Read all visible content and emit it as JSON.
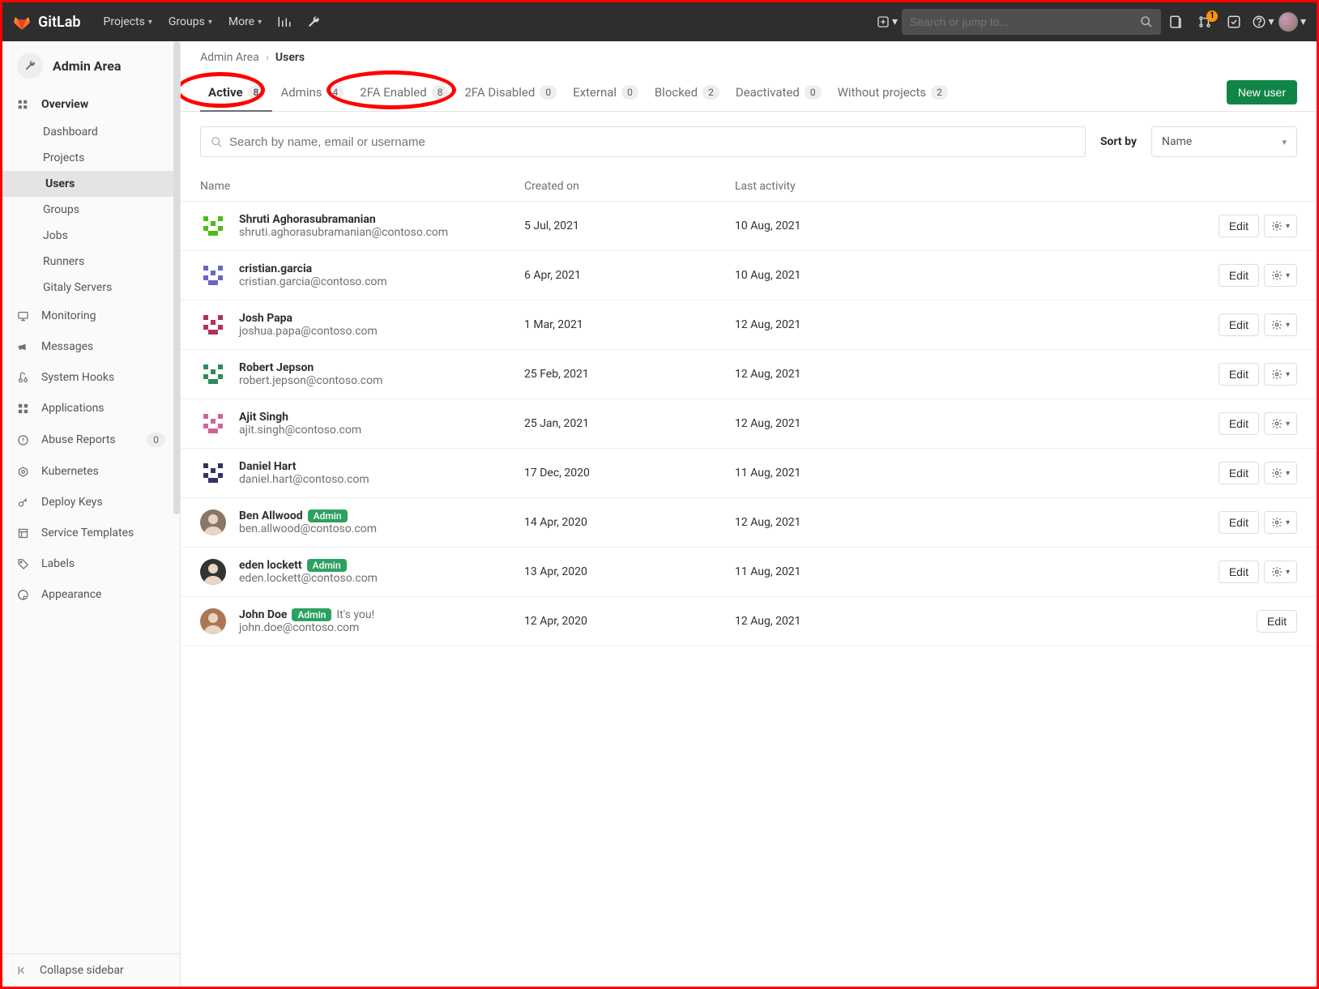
{
  "navbar": {
    "brand": "GitLab",
    "items": [
      "Projects",
      "Groups",
      "More"
    ],
    "search_placeholder": "Search or jump to...",
    "mr_badge": "1"
  },
  "sidebar": {
    "title": "Admin Area",
    "overview": {
      "label": "Overview",
      "items": [
        {
          "label": "Dashboard",
          "active": false
        },
        {
          "label": "Projects",
          "active": false
        },
        {
          "label": "Users",
          "active": true
        },
        {
          "label": "Groups",
          "active": false
        },
        {
          "label": "Jobs",
          "active": false
        },
        {
          "label": "Runners",
          "active": false
        },
        {
          "label": "Gitaly Servers",
          "active": false
        }
      ]
    },
    "links": [
      {
        "label": "Monitoring",
        "icon": "monitor"
      },
      {
        "label": "Messages",
        "icon": "bullhorn"
      },
      {
        "label": "System Hooks",
        "icon": "hook"
      },
      {
        "label": "Applications",
        "icon": "apps"
      },
      {
        "label": "Abuse Reports",
        "icon": "abuse",
        "count": "0"
      },
      {
        "label": "Kubernetes",
        "icon": "k8s"
      },
      {
        "label": "Deploy Keys",
        "icon": "key"
      },
      {
        "label": "Service Templates",
        "icon": "template"
      },
      {
        "label": "Labels",
        "icon": "label"
      },
      {
        "label": "Appearance",
        "icon": "appearance"
      }
    ],
    "collapse": "Collapse sidebar"
  },
  "breadcrumb": {
    "root": "Admin Area",
    "current": "Users"
  },
  "tabs": [
    {
      "label": "Active",
      "count": "8",
      "active": true
    },
    {
      "label": "Admins",
      "count": "4"
    },
    {
      "label": "2FA Enabled",
      "count": "8"
    },
    {
      "label": "2FA Disabled",
      "count": "0"
    },
    {
      "label": "External",
      "count": "0"
    },
    {
      "label": "Blocked",
      "count": "2"
    },
    {
      "label": "Deactivated",
      "count": "0"
    },
    {
      "label": "Without projects",
      "count": "2"
    }
  ],
  "actions": {
    "new_user": "New user",
    "edit": "Edit"
  },
  "filters": {
    "search_placeholder": "Search by name, email or username",
    "sort_label": "Sort by",
    "sort_value": "Name"
  },
  "table": {
    "headers": {
      "name": "Name",
      "created": "Created on",
      "activity": "Last activity"
    }
  },
  "badges": {
    "admin": "Admin",
    "its_you": "It's you!"
  },
  "users": [
    {
      "name": "Shruti Aghorasubramanian",
      "email": "shruti.aghorasubramanian@contoso.com",
      "created": "5 Jul, 2021",
      "activity": "10 Aug, 2021",
      "avatar": "identicon",
      "color": "#4cbb17",
      "admin": false,
      "its_you": false,
      "show_gear": true
    },
    {
      "name": "cristian.garcia",
      "email": "cristian.garcia@contoso.com",
      "created": "6 Apr, 2021",
      "activity": "10 Aug, 2021",
      "avatar": "identicon",
      "color": "#6666cc",
      "admin": false,
      "its_you": false,
      "show_gear": true
    },
    {
      "name": "Josh Papa",
      "email": "joshua.papa@contoso.com",
      "created": "1 Mar, 2021",
      "activity": "12 Aug, 2021",
      "avatar": "identicon",
      "color": "#b03060",
      "admin": false,
      "its_you": false,
      "show_gear": true
    },
    {
      "name": "Robert Jepson",
      "email": "robert.jepson@contoso.com",
      "created": "25 Feb, 2021",
      "activity": "12 Aug, 2021",
      "avatar": "identicon",
      "color": "#2e8b57",
      "admin": false,
      "its_you": false,
      "show_gear": true
    },
    {
      "name": "Ajit Singh",
      "email": "ajit.singh@contoso.com",
      "created": "25 Jan, 2021",
      "activity": "12 Aug, 2021",
      "avatar": "identicon",
      "color": "#cc6699",
      "admin": false,
      "its_you": false,
      "show_gear": true
    },
    {
      "name": "Daniel Hart",
      "email": "daniel.hart@contoso.com",
      "created": "17 Dec, 2020",
      "activity": "11 Aug, 2021",
      "avatar": "identicon",
      "color": "#333366",
      "admin": false,
      "its_you": false,
      "show_gear": true
    },
    {
      "name": "Ben Allwood",
      "email": "ben.allwood@contoso.com",
      "created": "14 Apr, 2020",
      "activity": "12 Aug, 2021",
      "avatar": "photo",
      "color": "#887766",
      "admin": true,
      "its_you": false,
      "show_gear": true
    },
    {
      "name": "eden lockett",
      "email": "eden.lockett@contoso.com",
      "created": "13 Apr, 2020",
      "activity": "11 Aug, 2021",
      "avatar": "photo",
      "color": "#333333",
      "admin": true,
      "its_you": false,
      "show_gear": true
    },
    {
      "name": "John Doe",
      "email": "john.doe@contoso.com",
      "created": "12 Apr, 2020",
      "activity": "12 Aug, 2021",
      "avatar": "photo",
      "color": "#aa7755",
      "admin": true,
      "its_you": true,
      "show_gear": false
    }
  ]
}
